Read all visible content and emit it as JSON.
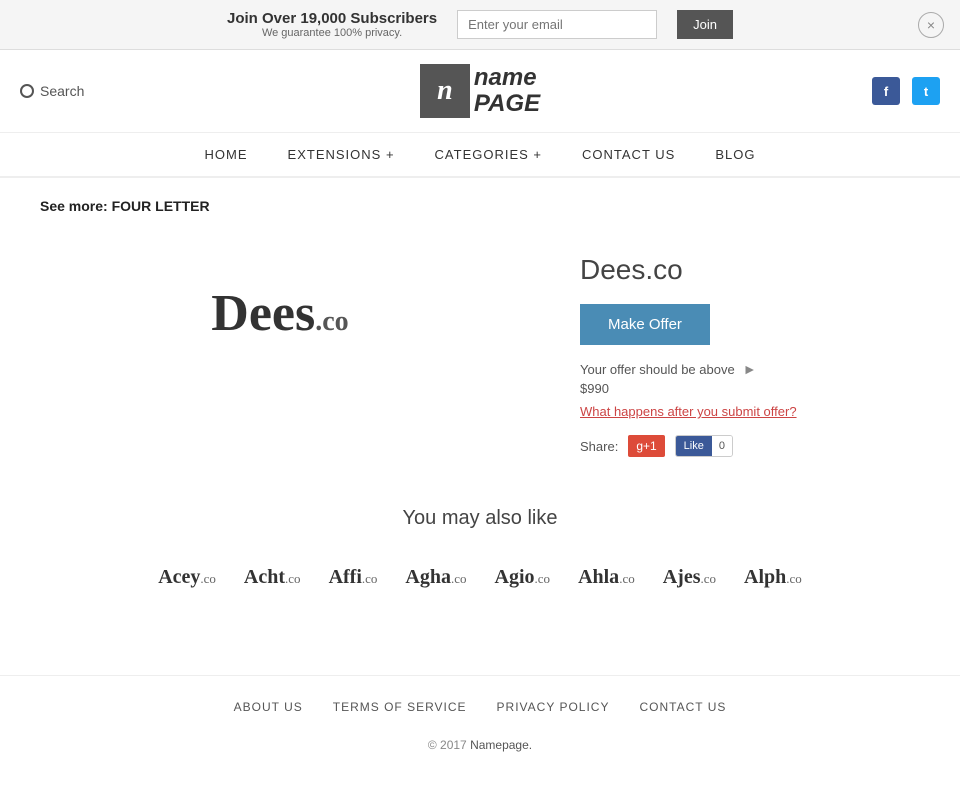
{
  "banner": {
    "headline": "Join Over 19,000 Subscribers",
    "subline": "We guarantee 100% privacy.",
    "email_placeholder": "Enter your email",
    "join_label": "Join",
    "close_label": "×"
  },
  "header": {
    "search_label": "Search",
    "logo_icon": "n",
    "logo_name": "name",
    "logo_page": "PAGE",
    "facebook_icon": "f",
    "twitter_icon": "t"
  },
  "nav": {
    "items": [
      {
        "label": "HOME",
        "id": "home"
      },
      {
        "label": "EXTENSIONS +",
        "id": "extensions"
      },
      {
        "label": "CATEGORIES +",
        "id": "categories"
      },
      {
        "label": "CONTACT  US",
        "id": "contact"
      },
      {
        "label": "BLOG",
        "id": "blog"
      }
    ]
  },
  "breadcrumb": {
    "prefix": "See more:",
    "link": "FOUR LETTER"
  },
  "domain": {
    "name": "Dees",
    "tld": ".co",
    "display": "Dees.co",
    "make_offer_label": "Make Offer",
    "offer_hint": "Your offer should be above",
    "offer_amount": "$990",
    "offer_link": "What happens after you submit offer?",
    "share_label": "Share:",
    "gplus_label": "g+1",
    "fb_like_label": "Like",
    "fb_count": "0"
  },
  "also_like": {
    "heading": "You may also like",
    "items": [
      {
        "name": "Acey",
        "tld": ".co"
      },
      {
        "name": "Acht",
        "tld": ".co"
      },
      {
        "name": "Affi",
        "tld": ".co"
      },
      {
        "name": "Agha",
        "tld": ".co"
      },
      {
        "name": "Agio",
        "tld": ".co"
      },
      {
        "name": "Ahla",
        "tld": ".co"
      },
      {
        "name": "Ajes",
        "tld": ".co"
      },
      {
        "name": "Alph",
        "tld": ".co"
      }
    ]
  },
  "footer": {
    "links": [
      {
        "label": "ABOUT  US",
        "id": "about"
      },
      {
        "label": "TERMS  OF  SERVICE",
        "id": "tos"
      },
      {
        "label": "PRIVACY  POLICY",
        "id": "privacy"
      },
      {
        "label": "CONTACT  US",
        "id": "contact"
      }
    ],
    "copy": "© 2017",
    "copy_link": "Namepage."
  }
}
